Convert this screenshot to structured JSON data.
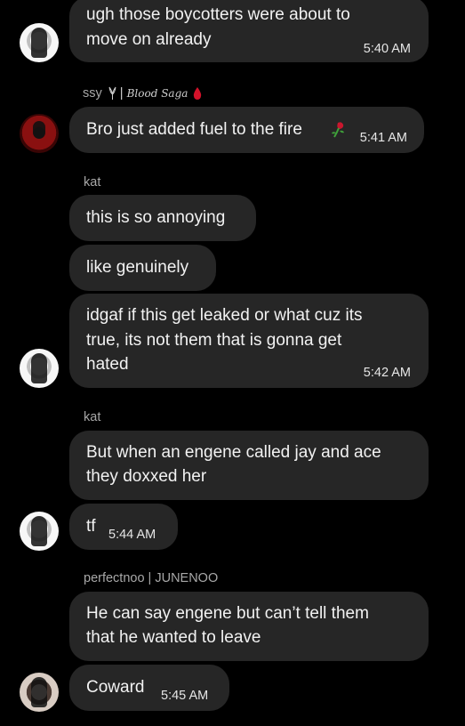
{
  "messages": {
    "m1": {
      "lines": [
        "ugh those boycotters were about to",
        "move on already"
      ],
      "time": "5:40 AM"
    },
    "m2": {
      "sender_prefix": "ssy",
      "sender_script": "Blood Saga",
      "text": "Bro just added fuel to the fire",
      "time": "5:41 AM"
    },
    "m3": {
      "sender": "kat",
      "text": "this is so annoying"
    },
    "m4": {
      "text": "like genuinely"
    },
    "m5": {
      "lines": [
        "idgaf if this get leaked or what cuz its",
        "true, its not them that is gonna get",
        "hated"
      ],
      "time": "5:42 AM"
    },
    "m6": {
      "sender": "kat",
      "lines": [
        "But when an engene called jay and ace",
        "they doxxed her"
      ]
    },
    "m7": {
      "text": "tf",
      "time": "5:44 AM"
    },
    "m8": {
      "sender": "perfectnoo | JUNENOO",
      "lines": [
        "He can say engene but can’t tell them",
        "that he wanted to leave"
      ]
    },
    "m9": {
      "text": "Coward",
      "time": "5:45 AM"
    }
  },
  "icons": {
    "avatar_1": "black-and-white-portrait-avatar",
    "avatar_2": "red-portrait-avatar",
    "avatar_3": "pale-portrait-avatar",
    "rose": "wilted-rose-emoji",
    "drop": "blood-drop-emoji",
    "tulip": "tulip-icon"
  },
  "colors": {
    "background": "#000000",
    "bubble": "#262626",
    "sender": "#a8a8a8"
  }
}
